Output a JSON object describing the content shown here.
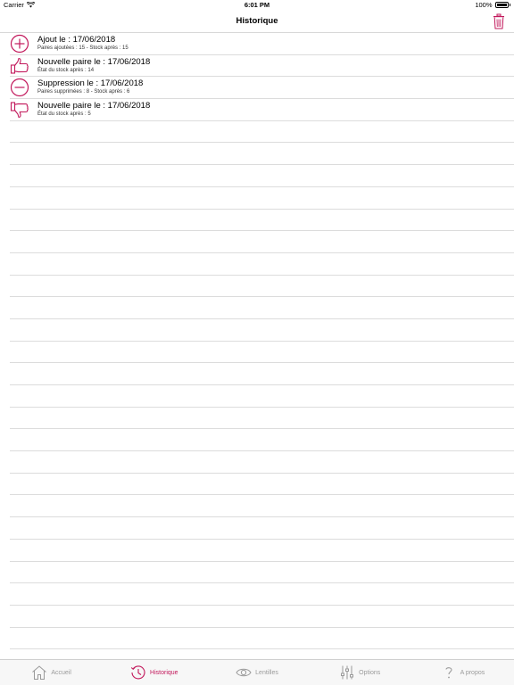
{
  "status_bar": {
    "carrier": "Carrier",
    "time": "6:01 PM",
    "battery": "100%"
  },
  "nav": {
    "title": "Historique"
  },
  "colors": {
    "accent": "#c2185b",
    "inactive": "#9a9a9a",
    "separator": "#dcdcdc"
  },
  "history": [
    {
      "icon": "plus-circle-icon",
      "title": "Ajout le : 17/06/2018",
      "subtitle": "Paires ajoutées : 15 - Stock après : 15"
    },
    {
      "icon": "thumbs-up-icon",
      "title": "Nouvelle paire le : 17/06/2018",
      "subtitle": "État du stock après : 14"
    },
    {
      "icon": "minus-circle-icon",
      "title": "Suppression le : 17/06/2018",
      "subtitle": "Paires supprimées : 8 - Stock après : 6"
    },
    {
      "icon": "thumbs-down-icon",
      "title": "Nouvelle paire le : 17/06/2018",
      "subtitle": "État du stock après : 5"
    }
  ],
  "tabs": [
    {
      "label": "Accueil",
      "icon": "home-icon",
      "active": false
    },
    {
      "label": "Historique",
      "icon": "history-icon",
      "active": true
    },
    {
      "label": "Lentilles",
      "icon": "eye-icon",
      "active": false
    },
    {
      "label": "Options",
      "icon": "sliders-icon",
      "active": false
    },
    {
      "label": "A propos",
      "icon": "question-icon",
      "active": false
    }
  ]
}
